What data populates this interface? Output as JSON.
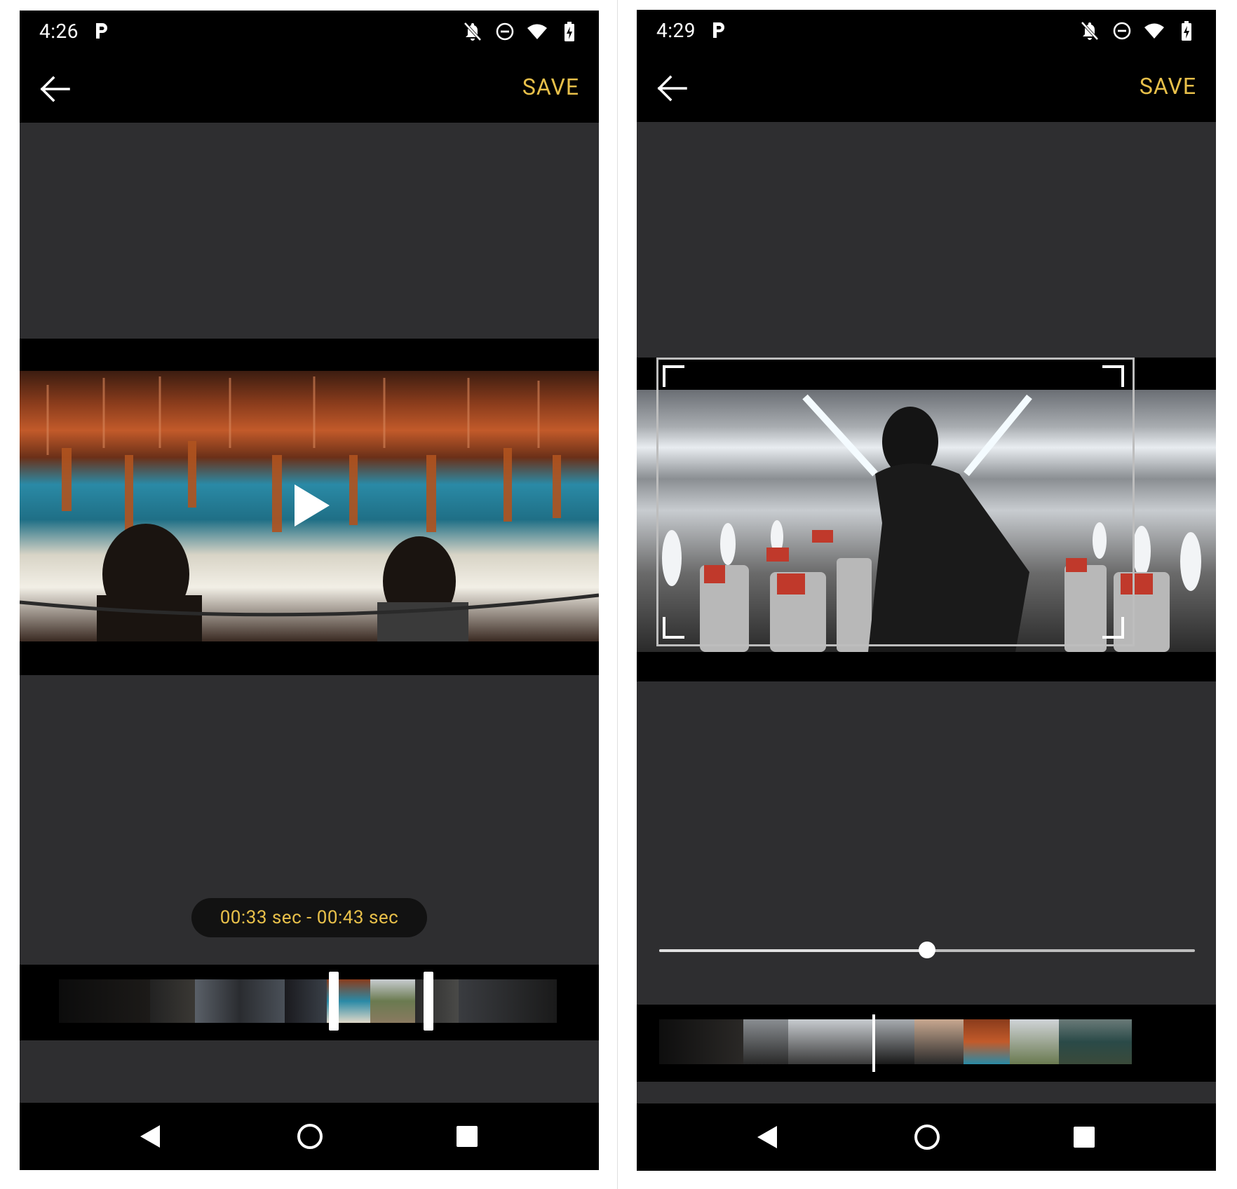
{
  "left": {
    "status_time": "4:26",
    "save_label": "SAVE",
    "trim_range": "00:33 sec - 00:43 sec",
    "video_icon": "play-icon"
  },
  "right": {
    "status_time": "4:29",
    "save_label": "SAVE",
    "crop_icon": "crop-frame-icon",
    "slider_value": 0.5
  },
  "status_icons": [
    "notifications-off-icon",
    "do-not-disturb-icon",
    "wifi-icon",
    "battery-charging-icon"
  ],
  "nav_icons": [
    "nav-back-icon",
    "nav-home-icon",
    "nav-recents-icon"
  ],
  "colors": {
    "accent": "#e8c04a",
    "background": "#2e2e30",
    "bar": "#000000"
  }
}
